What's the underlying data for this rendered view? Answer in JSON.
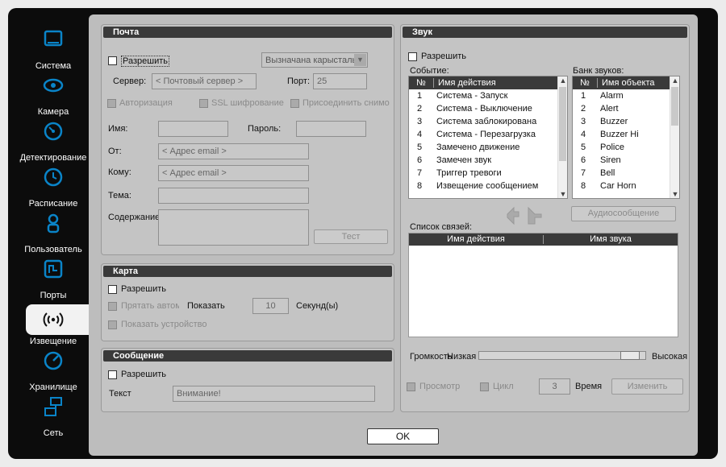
{
  "sidebar": {
    "items": [
      {
        "label": "Система",
        "icon": "monitor-icon"
      },
      {
        "label": "Камера",
        "icon": "eye-icon"
      },
      {
        "label": "Детектирование",
        "icon": "radar-icon"
      },
      {
        "label": "Расписание",
        "icon": "clock-icon"
      },
      {
        "label": "Пользователь",
        "icon": "user-icon"
      },
      {
        "label": "Порты",
        "icon": "ports-icon"
      },
      {
        "label": "Извещение",
        "icon": "broadcast-icon",
        "active": true
      },
      {
        "label": "Хранилище",
        "icon": "storage-icon"
      },
      {
        "label": "Сеть",
        "icon": "network-icon"
      }
    ]
  },
  "mail": {
    "title": "Почта",
    "enable_label": "Разрешить",
    "dropdown_value": "Вызначана карыстальн",
    "server_label": "Сервер:",
    "server_placeholder": "< Почтовый сервер >",
    "port_label": "Порт:",
    "port_value": "25",
    "auth_label": "Авторизация",
    "ssl_label": "SSL шифрование",
    "attach_label": "Присоединить снимок",
    "name_label": "Имя:",
    "password_label": "Пароль:",
    "from_label": "От:",
    "from_placeholder": "< Адрес email >",
    "to_label": "Кому:",
    "to_placeholder": "< Адрес email >",
    "subject_label": "Тема:",
    "content_label": "Содержание",
    "test_label": "Тест"
  },
  "map": {
    "title": "Карта",
    "enable_label": "Разрешить",
    "hide_auto_label": "Прятать автом",
    "show_label": "Показать",
    "seconds_value": "10",
    "seconds_label": "Секунд(ы)",
    "show_device_label": "Показать устройство"
  },
  "message": {
    "title": "Сообщение",
    "enable_label": "Разрешить",
    "text_label": "Текст",
    "text_value": "Внимание!"
  },
  "sound": {
    "title": "Звук",
    "enable_label": "Разрешить",
    "event_label": "Событие:",
    "bank_label": "Банк звуков:",
    "event_headers": [
      "№",
      "Имя действия"
    ],
    "events": [
      {
        "n": "1",
        "v": "Система - Запуск"
      },
      {
        "n": "2",
        "v": "Система - Выключение"
      },
      {
        "n": "3",
        "v": "Система заблокирована"
      },
      {
        "n": "4",
        "v": "Система - Перезагрузка"
      },
      {
        "n": "5",
        "v": "Замечено движение"
      },
      {
        "n": "6",
        "v": "Замечен звук"
      },
      {
        "n": "7",
        "v": "Триггер тревоги"
      },
      {
        "n": "8",
        "v": "Извещение сообщением"
      }
    ],
    "bank_headers": [
      "№",
      "Имя объекта"
    ],
    "bank": [
      {
        "n": "1",
        "v": "Alarm"
      },
      {
        "n": "2",
        "v": "Alert"
      },
      {
        "n": "3",
        "v": "Buzzer"
      },
      {
        "n": "4",
        "v": "Buzzer Hi"
      },
      {
        "n": "5",
        "v": "Police"
      },
      {
        "n": "6",
        "v": "Siren"
      },
      {
        "n": "7",
        "v": "Bell"
      },
      {
        "n": "8",
        "v": "Car Horn"
      }
    ],
    "audio_message_label": "Аудиосообщение",
    "links_label": "Список связей:",
    "links_headers": [
      "Имя действия",
      "Имя звука"
    ],
    "volume_label": "Громкость",
    "volume_low": "Низкая",
    "volume_high": "Высокая",
    "volume_level": 0.95,
    "preview_label": "Просмотр",
    "loop_label": "Цикл",
    "time_value": "3",
    "time_label": "Время",
    "change_label": "Изменить"
  },
  "ok_label": "OK"
}
